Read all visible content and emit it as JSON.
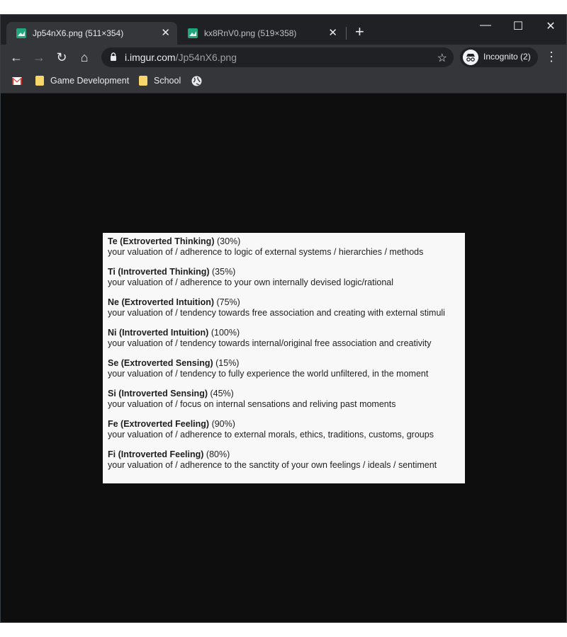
{
  "tabs": [
    {
      "title": "Jp54nX6.png (511×354)",
      "close": "✕"
    },
    {
      "title": "kx8RnV0.png (519×358)",
      "close": "✕"
    }
  ],
  "new_tab": "+",
  "window_controls": {
    "minimize": "—",
    "maximize": "☐",
    "close": "✕"
  },
  "nav": {
    "back": "←",
    "forward": "→",
    "reload": "↻",
    "home": "⌂"
  },
  "address": {
    "host": "i.imgur.com",
    "path": "/Jp54nX6.png",
    "star": "☆"
  },
  "profile": {
    "label": "Incognito (2)"
  },
  "menu": "⋮",
  "bookmarks": [
    {
      "label": "Game Development"
    },
    {
      "label": "School"
    }
  ],
  "image": {
    "entries": [
      {
        "name": "Te (Extroverted Thinking)",
        "pct": " (30%)",
        "desc": "your valuation of / adherence to logic of external systems / hierarchies / methods"
      },
      {
        "name": "Ti (Introverted Thinking)",
        "pct": " (35%)",
        "desc": "your valuation of / adherence to your own internally devised logic/rational"
      },
      {
        "name": "Ne (Extroverted Intuition)",
        "pct": " (75%)",
        "desc": "your valuation of / tendency towards free association and creating with external stimuli"
      },
      {
        "name": "Ni (Introverted Intuition)",
        "pct": " (100%)",
        "desc": "your valuation of / tendency towards internal/original free association and creativity"
      },
      {
        "name": "Se (Extroverted Sensing)",
        "pct": " (15%)",
        "desc": "your valuation of / tendency to fully experience the world unfiltered, in the moment"
      },
      {
        "name": "Si (Introverted Sensing)",
        "pct": " (45%)",
        "desc": "your valuation of / focus on internal sensations and reliving past moments"
      },
      {
        "name": "Fe (Extroverted Feeling)",
        "pct": " (90%)",
        "desc": "your valuation of / adherence to external morals, ethics, traditions, customs, groups"
      },
      {
        "name": "Fi (Introverted Feeling)",
        "pct": " (80%)",
        "desc": "your valuation of / adherence to the sanctity of your own feelings / ideals / sentiment"
      }
    ]
  }
}
